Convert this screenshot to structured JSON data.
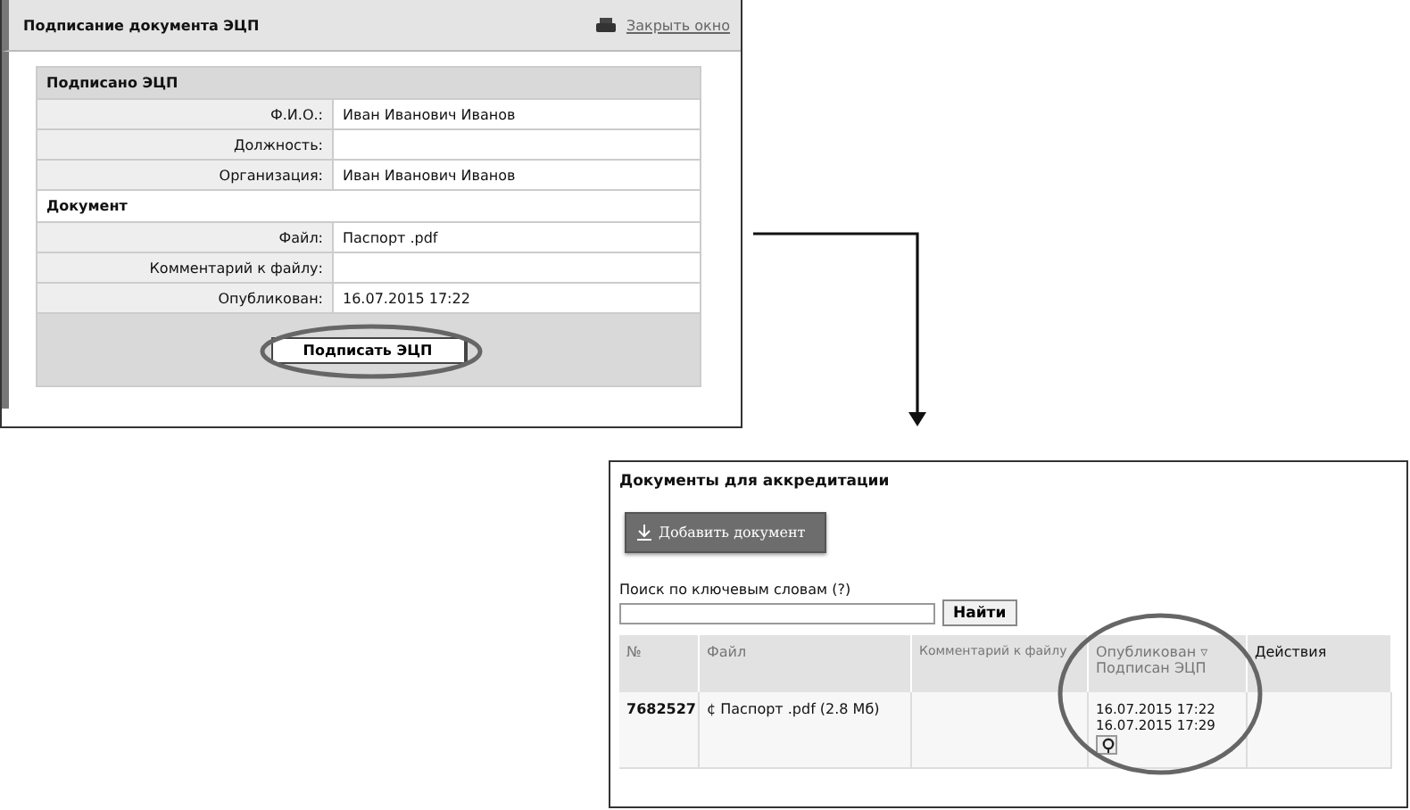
{
  "sign_window": {
    "title": "Подписание документа ЭЦП",
    "close_link": "Закрыть окно",
    "sections": [
      {
        "title": "Подписано ЭЦП",
        "rows": [
          {
            "label": "Ф.И.О.:",
            "value": "Иван Иванович Иванов"
          },
          {
            "label": "Должность:",
            "value": ""
          },
          {
            "label": "Организация:",
            "value": "Иван Иванович Иванов"
          }
        ]
      },
      {
        "title": "Документ",
        "rows": [
          {
            "label": "Файл:",
            "value": "Паспорт .pdf"
          },
          {
            "label": "Комментарий к файлу:",
            "value": ""
          },
          {
            "label": "Опубликован:",
            "value": "16.07.2015 17:22"
          }
        ]
      }
    ],
    "sign_button": "Подписать ЭЦП"
  },
  "documents_window": {
    "title": "Документы для аккредитации",
    "add_button": "Добавить документ",
    "search": {
      "label": "Поиск по ключевым словам (?)",
      "button": "Найти"
    },
    "table": {
      "columns": [
        "№",
        "Файл",
        "Комментарий к файлу",
        "Опубликован ▿",
        "Подписан ЭЦП",
        "Действия"
      ],
      "rows": [
        {
          "number": "7682527",
          "file_icon": "¢",
          "file": "Паспорт .pdf (2.8 Мб)",
          "published": "16.07.2015 17:22",
          "signed": "16.07.2015 17:29"
        }
      ]
    }
  }
}
